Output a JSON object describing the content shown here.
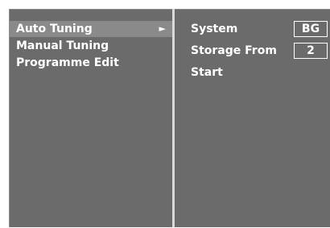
{
  "menu": {
    "items": [
      {
        "label": "Auto Tuning",
        "selected": true
      },
      {
        "label": "Manual Tuning",
        "selected": false
      },
      {
        "label": "Programme Edit",
        "selected": false
      }
    ],
    "arrow_icon": "►"
  },
  "settings": {
    "system": {
      "label": "System",
      "value": "BG"
    },
    "storage_from": {
      "label": "Storage From",
      "value": "2"
    },
    "start": {
      "label": "Start"
    }
  },
  "colors": {
    "panel_background": "#6b6b6b",
    "selected_highlight": "#8a8a8a",
    "divider": "#d9d9d9",
    "text": "#ffffff"
  }
}
